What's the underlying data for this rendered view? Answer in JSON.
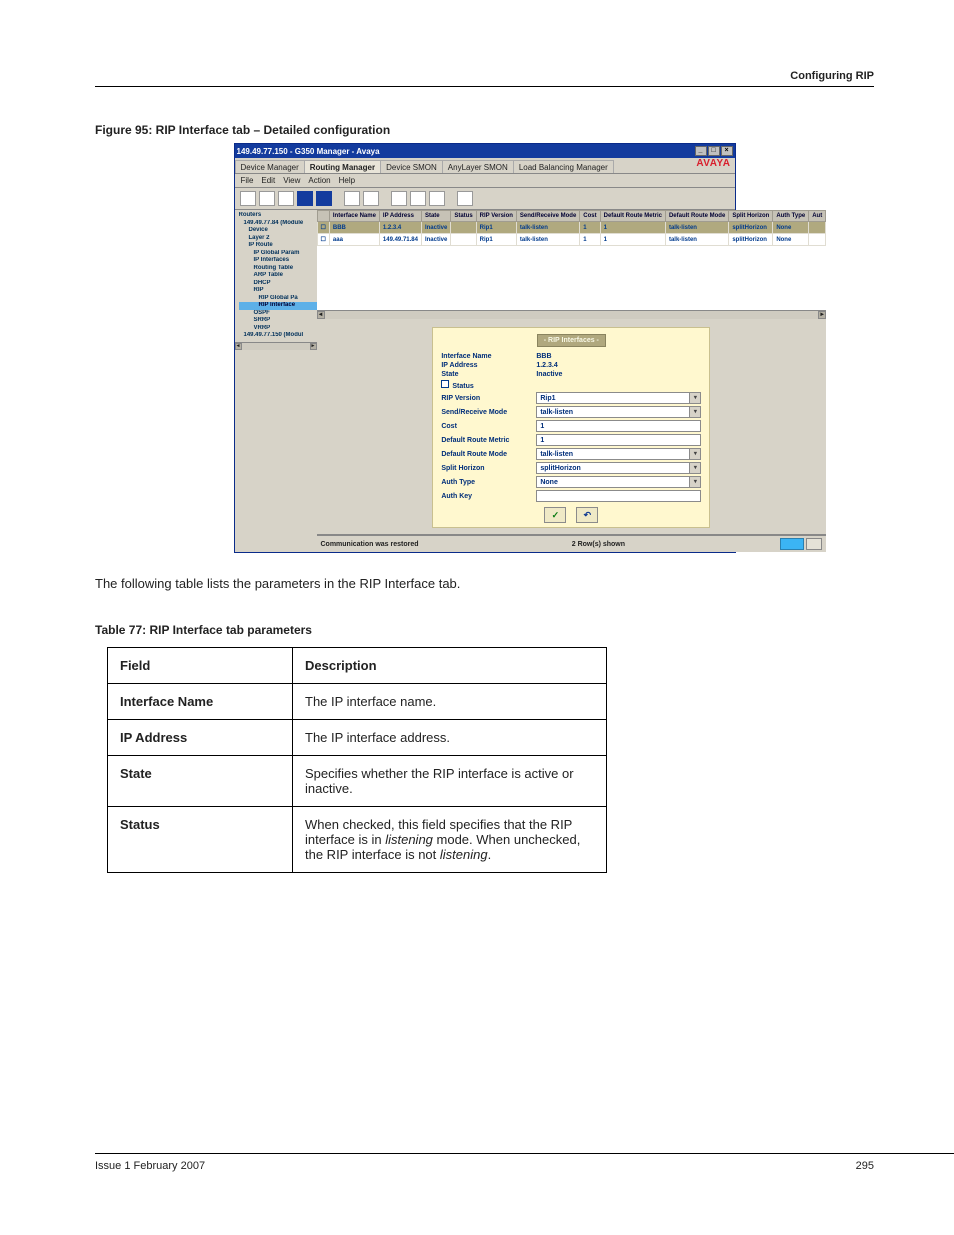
{
  "page": {
    "header_right": "Configuring RIP",
    "figure_caption": "Figure 95: RIP Interface tab – Detailed configuration",
    "table_intro": "The following table lists the parameters in the RIP Interface tab.",
    "table_title": "Table 77: RIP Interface tab parameters",
    "footer_left": "Issue 1 February 2007",
    "footer_right": "295"
  },
  "doc_table": {
    "head": [
      "Field",
      "Description"
    ],
    "rows": [
      [
        "Interface Name",
        "The IP interface name."
      ],
      [
        "IP Address",
        "The IP interface address."
      ],
      [
        "State",
        "Specifies whether the RIP interface is active or inactive."
      ],
      [
        "Status",
        "When checked, this field specifies that the RIP interface is in listening mode. When unchecked, the RIP interface is not listening."
      ]
    ]
  },
  "shot": {
    "title": "149.49.77.150 - G350 Manager - Avaya",
    "tabs": [
      "Device Manager",
      "Routing Manager",
      "Device SMON",
      "AnyLayer SMON",
      "Load Balancing Manager"
    ],
    "brand": "AVAYA",
    "menu": [
      "File",
      "Edit",
      "View",
      "Action",
      "Help"
    ],
    "tree": [
      {
        "l": 0,
        "t": "Routers"
      },
      {
        "l": 1,
        "t": "149.49.77.84 (Module"
      },
      {
        "l": 2,
        "t": "Device"
      },
      {
        "l": 2,
        "t": "Layer 2"
      },
      {
        "l": 2,
        "t": "IP Route"
      },
      {
        "l": 3,
        "t": "IP Global Param"
      },
      {
        "l": 3,
        "t": "IP Interfaces"
      },
      {
        "l": 3,
        "t": "Routing Table"
      },
      {
        "l": 3,
        "t": "ARP Table"
      },
      {
        "l": 3,
        "t": "DHCP"
      },
      {
        "l": 3,
        "t": "RIP"
      },
      {
        "l": 4,
        "t": "RIP Global Pa"
      },
      {
        "l": 4,
        "t": "RIP Interface",
        "sel": true
      },
      {
        "l": 3,
        "t": "OSPF"
      },
      {
        "l": 3,
        "t": "SRRP"
      },
      {
        "l": 3,
        "t": "VRRP"
      },
      {
        "l": 1,
        "t": "149.49.77.150 (Modul"
      }
    ],
    "grid": {
      "cols": [
        "",
        "Interface Name",
        "IP Address",
        "State",
        "Status",
        "RIP Version",
        "Send/Receive Mode",
        "Cost",
        "Default Route Metric",
        "Default Route Mode",
        "Split Horizon",
        "Auth Type",
        "Aut"
      ],
      "rows": [
        [
          "☐",
          "BBB",
          "1.2.3.4",
          "Inactive",
          "",
          "Rip1",
          "talk-listen",
          "1",
          "1",
          "talk-listen",
          "splitHorizon",
          "None",
          ""
        ],
        [
          "☐",
          "aaa",
          "149.49.71.84",
          "Inactive",
          "",
          "Rip1",
          "talk-listen",
          "1",
          "1",
          "talk-listen",
          "splitHorizon",
          "None",
          ""
        ]
      ]
    },
    "form": {
      "title": "- RIP Interfaces -",
      "rows": [
        {
          "lab": "Interface Name",
          "type": "text",
          "val": "BBB"
        },
        {
          "lab": "IP Address",
          "type": "text",
          "val": "1.2.3.4"
        },
        {
          "lab": "State",
          "type": "text",
          "val": "Inactive"
        },
        {
          "lab": "Status",
          "type": "check",
          "val": ""
        },
        {
          "lab": "RIP Version",
          "type": "select",
          "val": "Rip1"
        },
        {
          "lab": "Send/Receive Mode",
          "type": "select",
          "val": "talk-listen"
        },
        {
          "lab": "Cost",
          "type": "input",
          "val": "1"
        },
        {
          "lab": "Default Route Metric",
          "type": "input",
          "val": "1"
        },
        {
          "lab": "Default Route Mode",
          "type": "select",
          "val": "talk-listen"
        },
        {
          "lab": "Split Horizon",
          "type": "select",
          "val": "splitHorizon"
        },
        {
          "lab": "Auth Type",
          "type": "select",
          "val": "None"
        },
        {
          "lab": "Auth Key",
          "type": "input",
          "val": ""
        }
      ]
    },
    "status_left": "Communication was restored",
    "status_mid": "2 Row(s) shown"
  }
}
